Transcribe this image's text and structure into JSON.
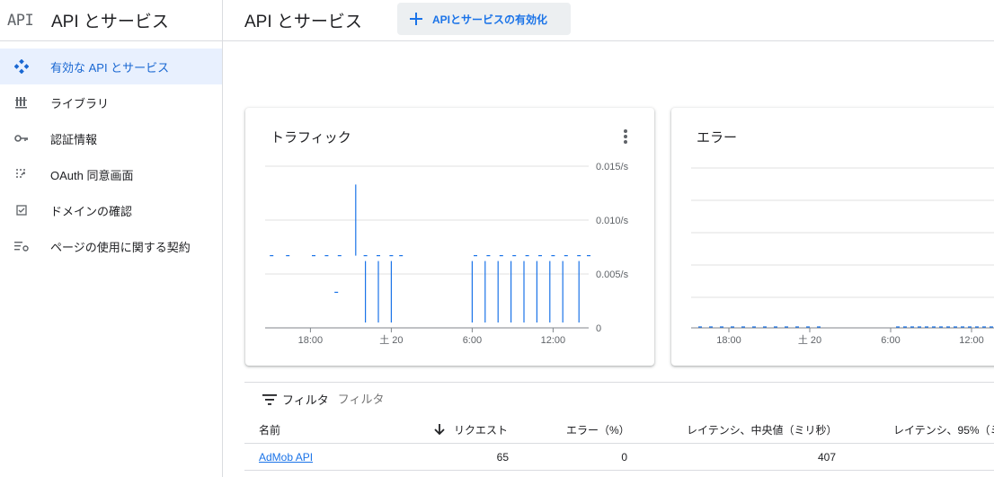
{
  "sidebar": {
    "logo": "API",
    "title": "API とサービス",
    "items": [
      {
        "label": "有効な API とサービス",
        "icon": "api-diamond-icon",
        "active": true
      },
      {
        "label": "ライブラリ",
        "icon": "library-icon"
      },
      {
        "label": "認証情報",
        "icon": "key-icon"
      },
      {
        "label": "OAuth 同意画面",
        "icon": "oauth-consent-icon"
      },
      {
        "label": "ドメインの確認",
        "icon": "checkbox-icon"
      },
      {
        "label": "ページの使用に関する契約",
        "icon": "settings-list-icon"
      }
    ]
  },
  "header": {
    "title": "API とサービス",
    "enable_button": "APIとサービスの有効化"
  },
  "charts": {
    "traffic_title": "トラフィック",
    "errors_title": "エラー"
  },
  "chart_data": [
    {
      "type": "line",
      "title": "トラフィック",
      "x_ticks": [
        "18:00",
        "土 20",
        "6:00",
        "12:00"
      ],
      "y_ticks": [
        "0",
        "0.005/s",
        "0.010/s",
        "0.015/s"
      ],
      "ylim": [
        0,
        0.015
      ],
      "unit": "/s",
      "grid": true,
      "series": [
        {
          "segments": [
            {
              "x": 0.02,
              "y": 0.0067
            },
            {
              "x": 0.07,
              "y": 0.0067
            },
            {
              "x": 0.15,
              "y": 0.0067
            },
            {
              "x": 0.19,
              "y": 0.0067
            },
            {
              "x": 0.23,
              "y": 0.0067
            },
            {
              "x": 0.22,
              "y": 0.0033
            },
            {
              "x": 0.28,
              "y": 0.0133
            },
            {
              "x": 0.31,
              "y": 0.0067
            },
            {
              "x": 0.35,
              "y": 0.0067
            },
            {
              "x": 0.39,
              "y": 0.0067
            },
            {
              "x": 0.42,
              "y": 0.0067
            },
            {
              "x": 0.65,
              "y": 0.0067
            },
            {
              "x": 0.69,
              "y": 0.0067
            },
            {
              "x": 0.73,
              "y": 0.0067
            },
            {
              "x": 0.77,
              "y": 0.0067
            },
            {
              "x": 0.81,
              "y": 0.0067
            },
            {
              "x": 0.85,
              "y": 0.0067
            },
            {
              "x": 0.89,
              "y": 0.0067
            },
            {
              "x": 0.93,
              "y": 0.0067
            },
            {
              "x": 0.97,
              "y": 0.0067
            },
            {
              "x": 1.0,
              "y": 0.0067
            }
          ],
          "drops": [
            0.31,
            0.35,
            0.39,
            0.64,
            0.68,
            0.72,
            0.76,
            0.8,
            0.84,
            0.88,
            0.92,
            0.97
          ]
        }
      ]
    },
    {
      "type": "line",
      "title": "エラー",
      "x_ticks": [
        "18:00",
        "土 20",
        "6:00",
        "12:00"
      ],
      "grid": true,
      "series": [
        {
          "values": "near zero"
        }
      ]
    }
  ],
  "filter": {
    "label": "フィルタ",
    "placeholder": "フィルタ"
  },
  "table": {
    "headers": [
      "名前",
      "リクエスト",
      "エラー（%）",
      "レイテンシ、中央値（ミリ秒）",
      "レイテンシ、95%（ミ"
    ],
    "rows": [
      {
        "name": "AdMob API",
        "requests": "65",
        "errors": "0",
        "latency_median": "407",
        "latency_95": ""
      }
    ]
  }
}
